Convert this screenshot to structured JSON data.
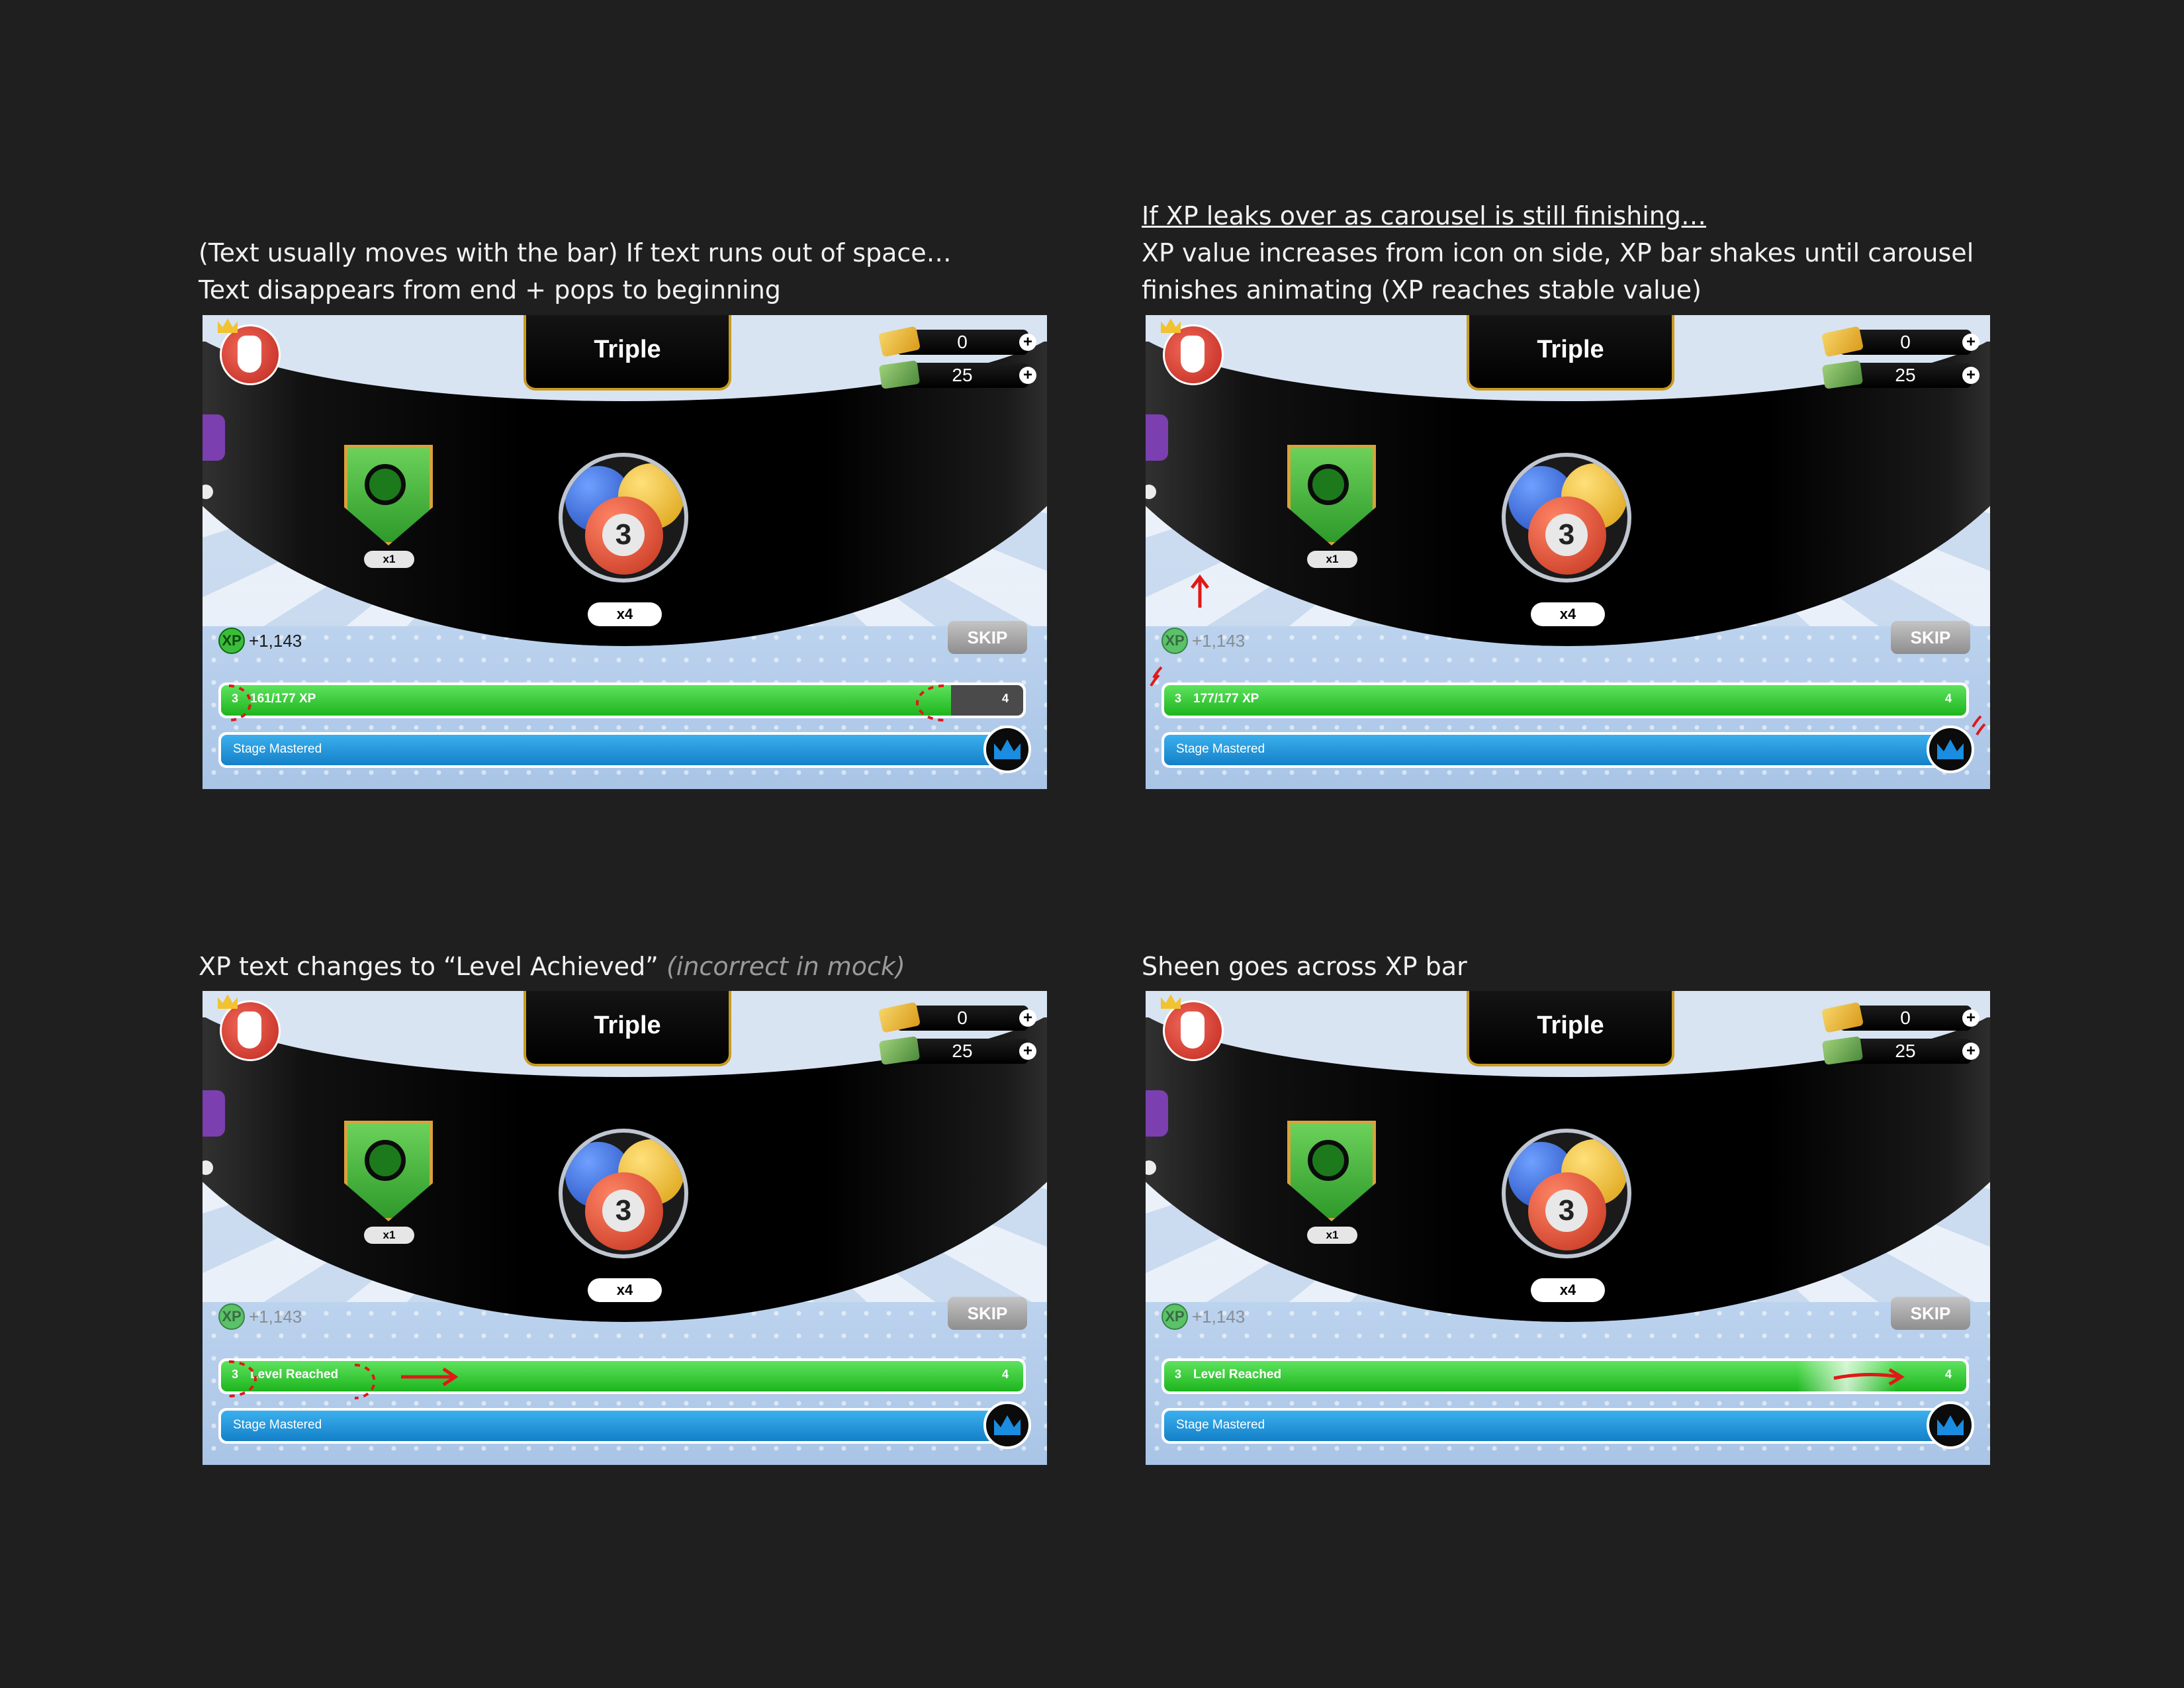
{
  "captions": {
    "tl": {
      "line1": "(Text usually moves with the bar) If text runs out of space…",
      "line2": "Text disappears from end + pops to beginning"
    },
    "tr": {
      "line1": "If XP leaks over as carousel is still finishing…",
      "line2": "XP value increases from icon on side, XP bar shakes until carousel",
      "line3": "finishes animating (XP reaches stable value)"
    },
    "bl": {
      "main": "XP text changes to “Level Achieved” ",
      "note": "(incorrect in mock)"
    },
    "br": {
      "line1": "Sheen goes across XP bar"
    }
  },
  "game": {
    "title": "Triple",
    "gold_value": "0",
    "cash_value": "25",
    "plus_label": "+",
    "shield_multiplier": "x1",
    "ball_number": "3",
    "ball_multiplier": "x4",
    "xp_icon_label": "XP",
    "xp_earned": "+1,143",
    "skip_label": "SKIP",
    "stage_label": "Stage Mastered",
    "current_level": "3",
    "next_level": "4"
  },
  "panels": [
    {
      "xp_text": "161/177 XP",
      "xp_fill_fraction": 0.91
    },
    {
      "xp_text": "177/177 XP",
      "xp_fill_fraction": 1.0
    },
    {
      "xp_text": "Level Reached",
      "xp_fill_fraction": 1.0
    },
    {
      "xp_text": "Level Reached",
      "xp_fill_fraction": 1.0
    }
  ],
  "colors": {
    "background": "#1f1f1f",
    "xp_green": "#1eb51e",
    "stage_blue": "#1480c8",
    "annotation_red": "#e01818",
    "title_border": "#c89a20"
  },
  "icons": [
    "avatar-icon",
    "gold-bar-icon",
    "cash-icon",
    "plus-icon",
    "shield-badge-icon",
    "ball-icon",
    "xp-icon",
    "crown-icon"
  ]
}
